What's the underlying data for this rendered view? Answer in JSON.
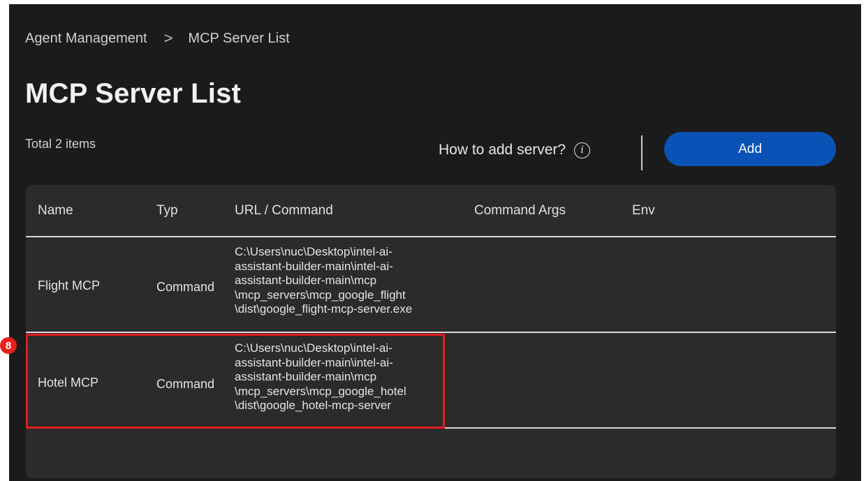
{
  "breadcrumb": {
    "parent": "Agent Management",
    "separator": ">",
    "current": "MCP Server List"
  },
  "page": {
    "title": "MCP Server List",
    "total": "Total 2 items"
  },
  "actions": {
    "help_text": "How to add server?",
    "info_icon": "info-icon",
    "add_label": "Add"
  },
  "table": {
    "headers": [
      "Name",
      "Typ",
      "URL / Command",
      "Command Args",
      "Env"
    ],
    "rows": [
      {
        "name": "Flight MCP",
        "type": "Command",
        "url": "C:\\Users\\nuc\\Desktop\\intel-ai-\nassistant-builder-main\\intel-ai-\nassistant-builder-main\\mcp\n\\mcp_servers\\mcp_google_flight\n\\dist\\google_flight-mcp-server.exe",
        "args": "",
        "env": ""
      },
      {
        "name": "Hotel MCP",
        "type": "Command",
        "url": "C:\\Users\\nuc\\Desktop\\intel-ai-\nassistant-builder-main\\intel-ai-\nassistant-builder-main\\mcp\n\\mcp_servers\\mcp_google_hotel\n\\dist\\google_hotel-mcp-server",
        "args": "",
        "env": ""
      }
    ]
  },
  "annotation": {
    "badge": "8"
  },
  "colors": {
    "background": "#1b1b1b",
    "panel": "#2b2b2b",
    "accent": "#0a52b5",
    "highlight": "#e01c22"
  }
}
